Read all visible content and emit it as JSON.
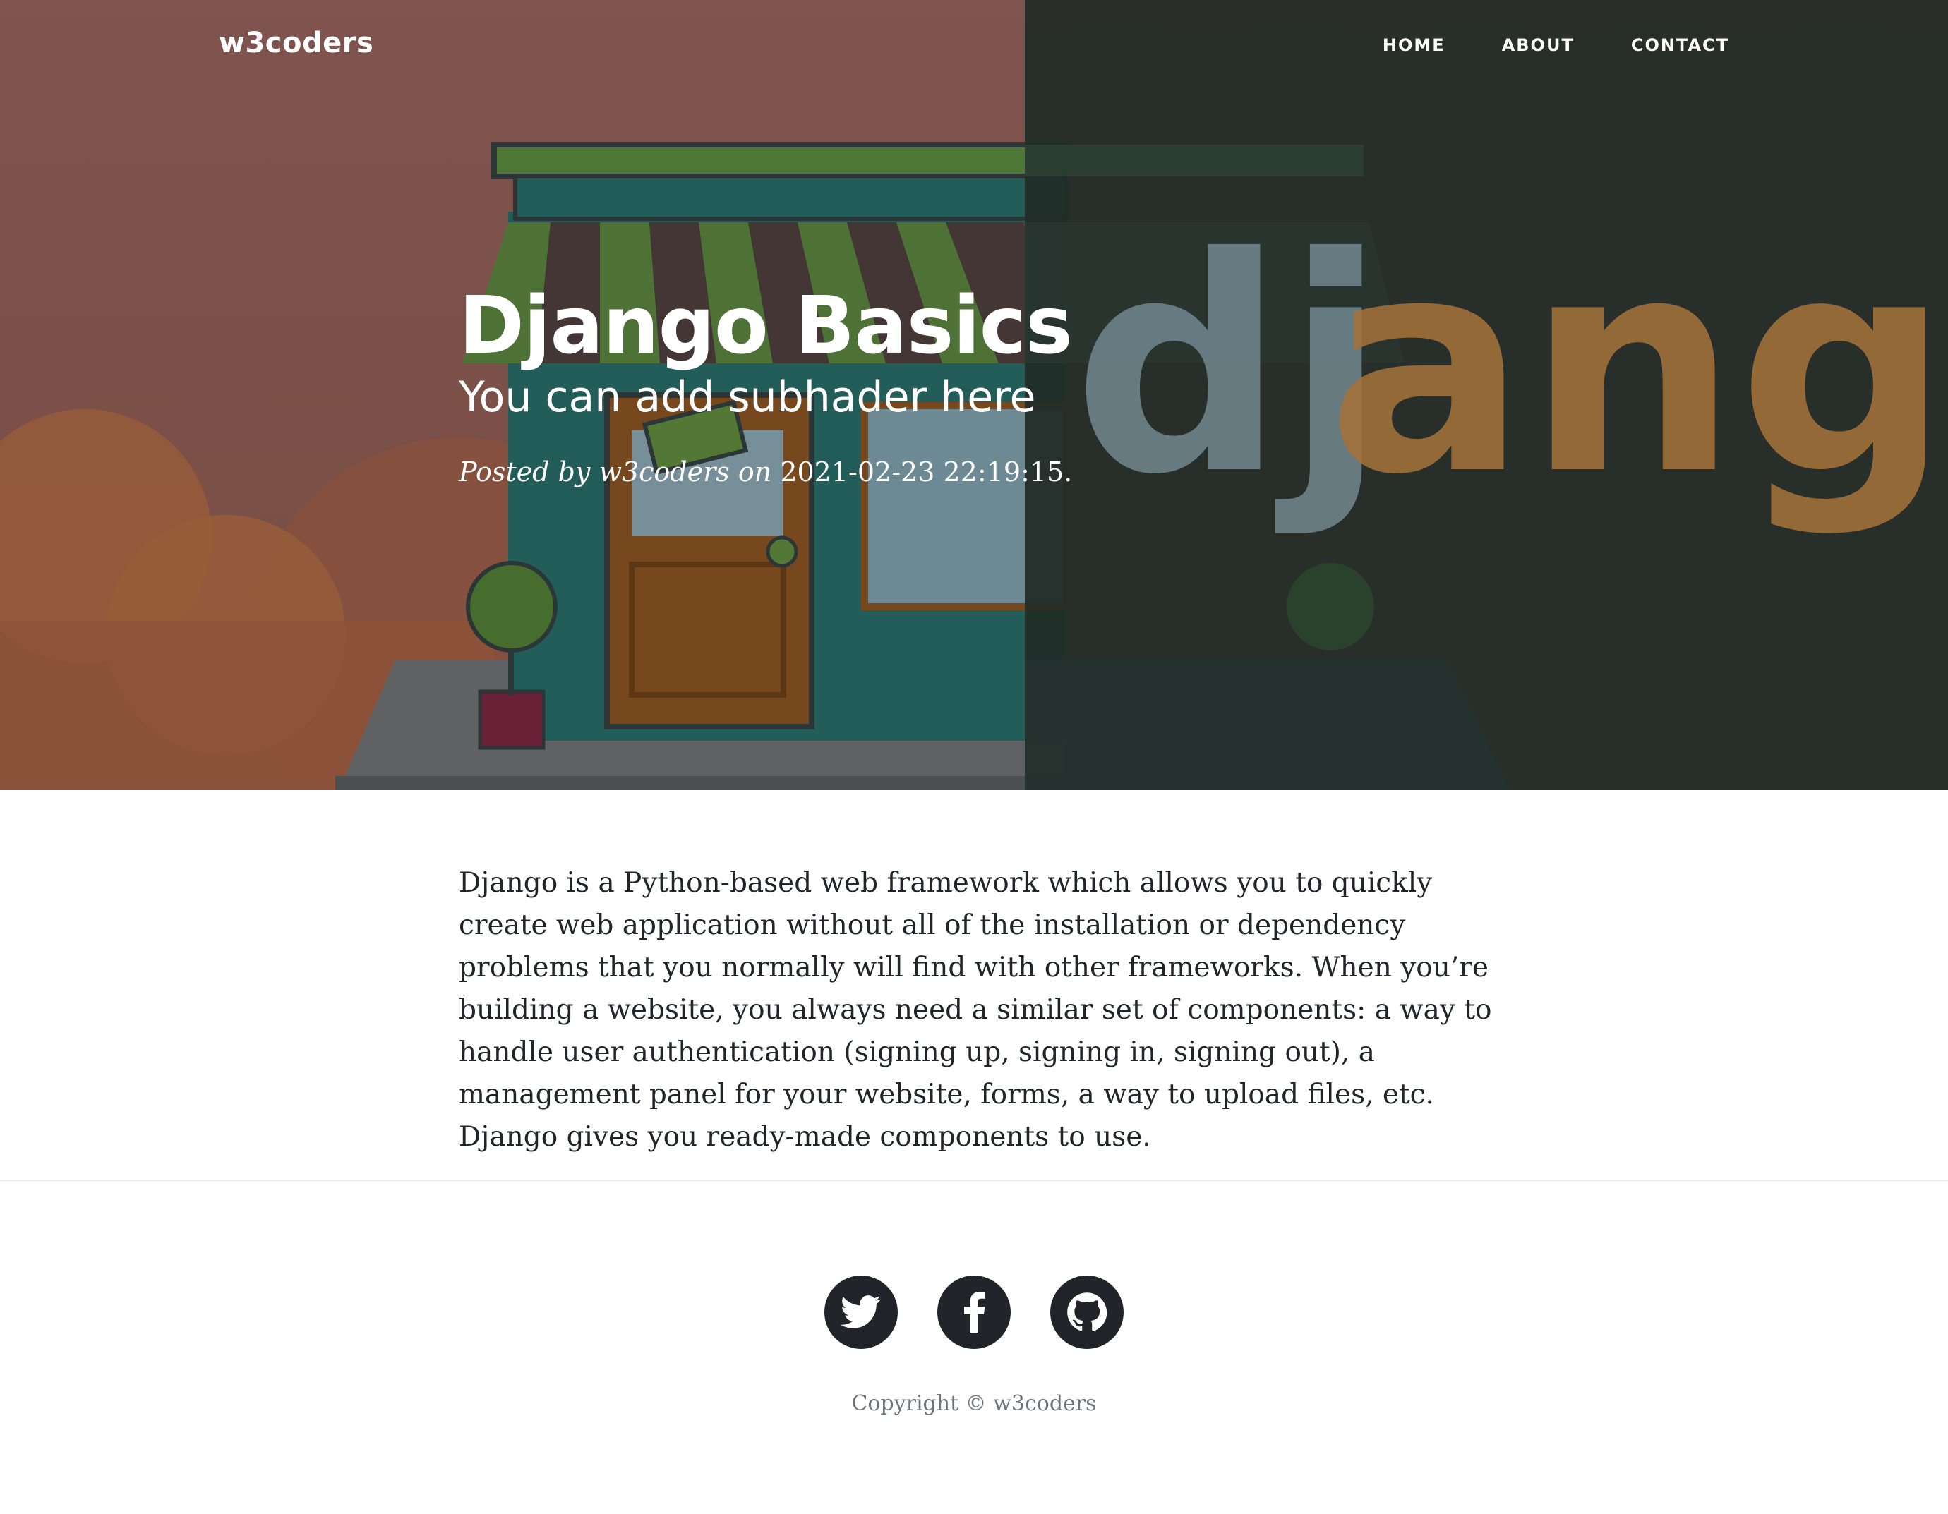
{
  "nav": {
    "brand": "w3coders",
    "links": [
      "HOME",
      "ABOUT",
      "CONTACT"
    ]
  },
  "hero": {
    "title": "Django Basics",
    "subtitle": "You can add subhader here",
    "meta_prefix": "Posted by w3coders on",
    "meta_date": "2021-02-23 22:19:15.",
    "image_wordmark": "django"
  },
  "article": {
    "body": "Django is a Python-based web framework which allows you to quickly create web application without all of the installation or dependency problems that you normally will find with other frameworks. When you’re building a website, you always need a similar set of components: a way to handle user authentication (signing up, signing in, signing out), a management panel for your website, forms, a way to upload files, etc. Django gives you ready-made components to use."
  },
  "footer": {
    "social": [
      "twitter-icon",
      "facebook-icon",
      "github-icon"
    ],
    "copyright": "Copyright © w3coders"
  },
  "colors": {
    "dark": "#212529",
    "muted": "#6c757d",
    "hero_left": "#955e58",
    "hero_right": "#222d28",
    "django_orange": "#c0823f"
  }
}
